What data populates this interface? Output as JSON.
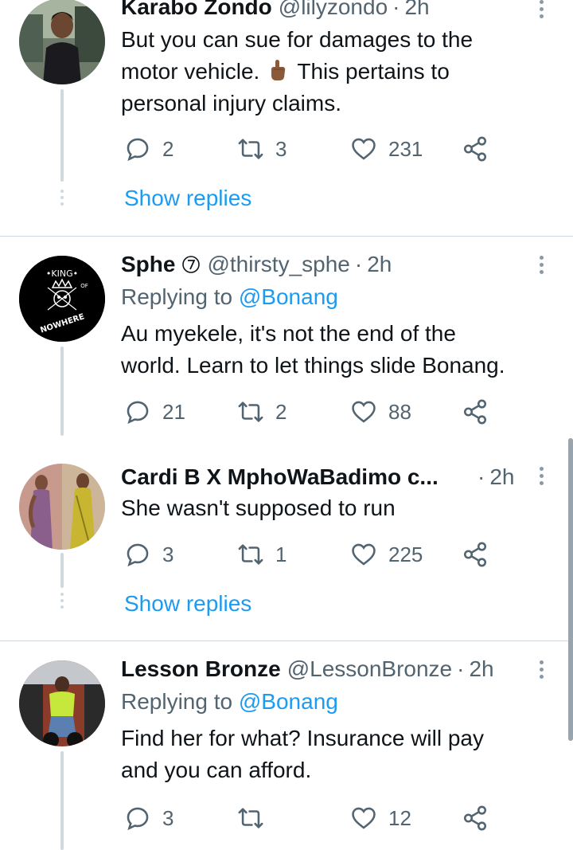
{
  "tweets": [
    {
      "name": "Karabo Zondo",
      "handle": "@lilyzondo",
      "sep": "·",
      "time": "2h",
      "text_line1": "But you can sue for damages to the",
      "text_line2a": "motor vehicle.",
      "text_line2b": "This pertains to",
      "text_line3": "personal injury claims.",
      "emoji_icon": "hand-pointing-up-emoji",
      "replies": "2",
      "retweets": "3",
      "likes": "231",
      "show_replies": "Show replies"
    },
    {
      "name": "Sphe",
      "verified_badge": "⑦",
      "handle": "@thirsty_sphe",
      "sep": "·",
      "time": "2h",
      "replying_prefix": "Replying to",
      "replying_to": "@Bonang",
      "text_line1": "Au myekele, it's not the end of the",
      "text_line2": "world. Learn to let things slide Bonang.",
      "avatar_text_top": "•KING•",
      "avatar_text_of": "OF",
      "avatar_text_bottom": "NOWHERE",
      "replies": "21",
      "retweets": "2",
      "likes": "88"
    },
    {
      "name": "Cardi B X MphoWaBadimo c...",
      "sep": "·",
      "time": "2h",
      "text_line1": "She wasn't supposed to run",
      "replies": "3",
      "retweets": "1",
      "likes": "225",
      "show_replies": "Show replies"
    },
    {
      "name": "Lesson Bronze",
      "handle": "@LessonBronze",
      "sep": "·",
      "time": "2h",
      "replying_prefix": "Replying to",
      "replying_to": "@Bonang",
      "text_line1": "Find her for what? Insurance will pay",
      "text_line2": "and you can afford.",
      "replies": "3",
      "retweets": "",
      "likes": "12"
    }
  ],
  "colors": {
    "link": "#1d9bf0",
    "secondary_text": "#536471",
    "thread_line": "#cfd9de"
  }
}
